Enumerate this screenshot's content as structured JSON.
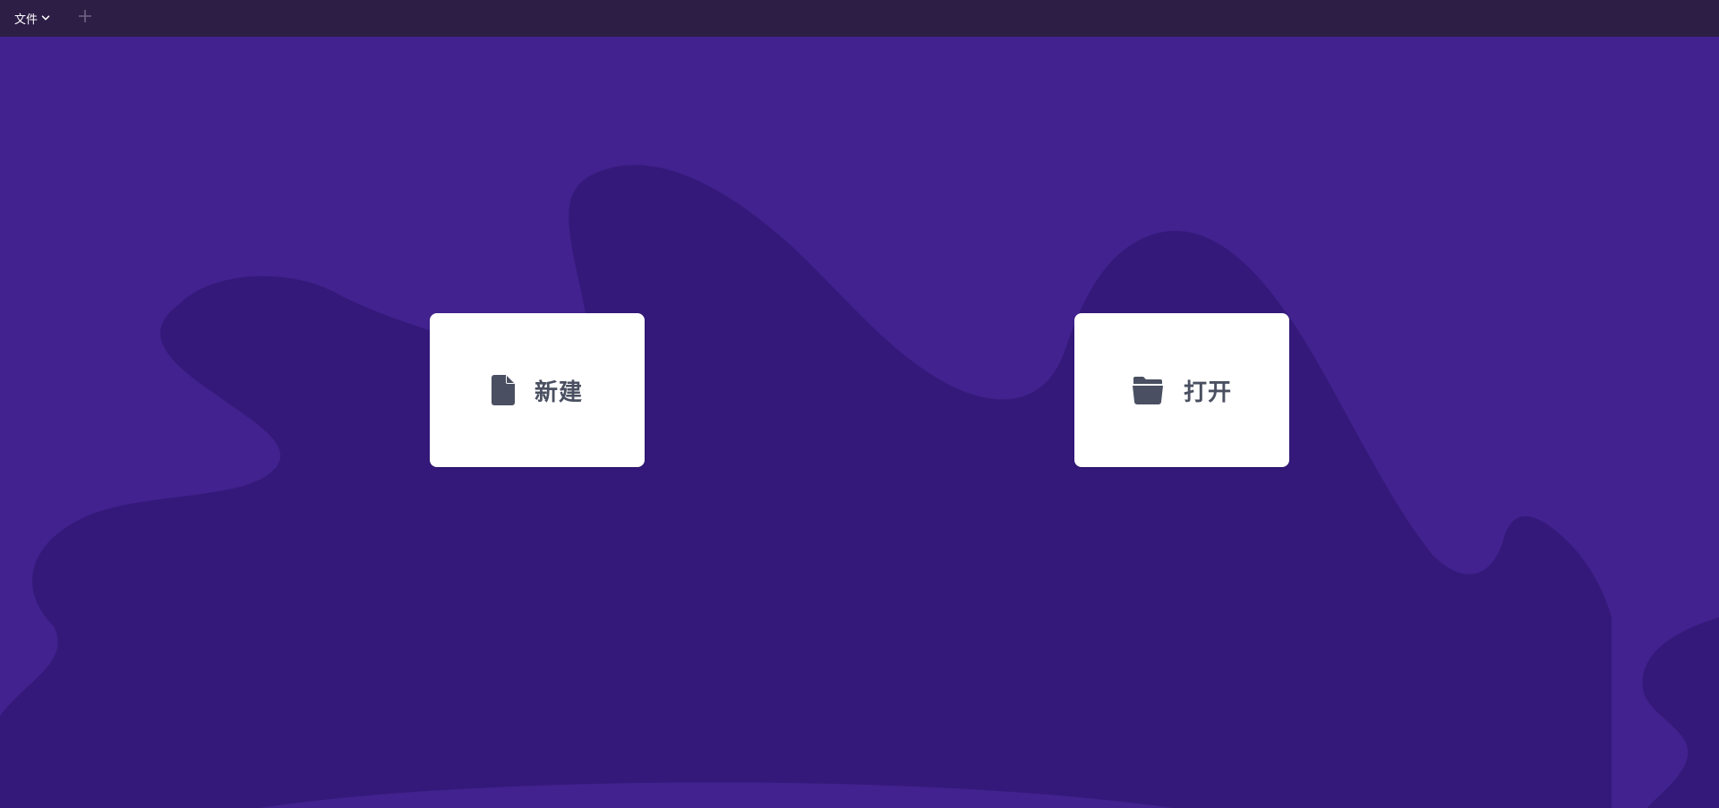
{
  "topbar": {
    "file_menu_label": "文件",
    "file_menu_icon": "chevron-down-icon",
    "add_tab_icon": "plus-icon"
  },
  "cards": {
    "new": {
      "label": "新建",
      "icon": "file-icon"
    },
    "open": {
      "label": "打开",
      "icon": "folder-open-icon"
    }
  },
  "colors": {
    "topbar_bg": "#2c1e45",
    "background": "#42228e",
    "background_shape": "#34197a",
    "card_bg": "#ffffff",
    "card_text": "#4a5061"
  }
}
